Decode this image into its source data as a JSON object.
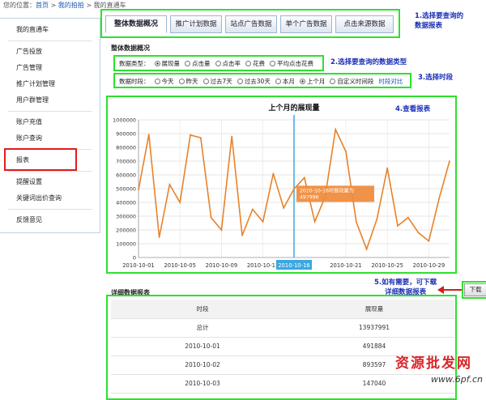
{
  "breadcrumb": {
    "prefix": "您的位置：",
    "home": "首页",
    "sep1": " > ",
    "crumb2": "我的拍拍",
    "sep2": " > ",
    "crumb3": "我的直通车"
  },
  "sidebar": {
    "items": [
      {
        "label": "我的直通车"
      },
      {
        "label": "广告投放"
      },
      {
        "label": "广告管理"
      },
      {
        "label": "推广计划管理"
      },
      {
        "label": "用户群管理"
      },
      {
        "label": "账户充值"
      },
      {
        "label": "账户查询"
      },
      {
        "label": "报表"
      },
      {
        "label": "提醒设置"
      },
      {
        "label": "关键词出价查询"
      },
      {
        "label": "反馈意见"
      }
    ]
  },
  "tabs": [
    {
      "label": "整体数据概况"
    },
    {
      "label": "推广计划数据"
    },
    {
      "label": "站点广告数据"
    },
    {
      "label": "单个广告数据"
    },
    {
      "label": "点击来源数据"
    }
  ],
  "annotations": {
    "a1": "1.选择要查询的",
    "a1b": "数据报表",
    "a2": "2.选择要查询的数据类型",
    "a3": "3.选择时段",
    "a4": "4.查看报表",
    "a5": "5.如有需要，可下载",
    "a5b": "详细数据报表"
  },
  "overview_title": "整体数据概况",
  "data_type": {
    "label": "数据类型：",
    "options": [
      "展现量",
      "点击量",
      "点击率",
      "花费",
      "平均点击花费"
    ],
    "selected": 0
  },
  "period": {
    "label": "数据时段：",
    "options": [
      "今天",
      "昨天",
      "过去7天",
      "过去30天",
      "本月",
      "上个月",
      "自定义时间段"
    ],
    "selected": 5,
    "compare_link": "时段对比"
  },
  "chart_data": {
    "type": "line",
    "title": "上个月的展现量",
    "x": [
      "2010-10-01",
      "2010-10-02",
      "2010-10-03",
      "2010-10-04",
      "2010-10-05",
      "2010-10-06",
      "2010-10-07",
      "2010-10-08",
      "2010-10-09",
      "2010-10-10",
      "2010-10-11",
      "2010-10-12",
      "2010-10-13",
      "2010-10-14",
      "2010-10-15",
      "2010-10-16",
      "2010-10-17",
      "2010-10-18",
      "2010-10-19",
      "2010-10-20",
      "2010-10-21",
      "2010-10-22",
      "2010-10-23",
      "2010-10-24",
      "2010-10-25",
      "2010-10-26",
      "2010-10-27",
      "2010-10-28",
      "2010-10-29",
      "2010-10-30",
      "2010-10-31"
    ],
    "series": [
      {
        "values": [
          491884,
          893597,
          147040,
          530000,
          400000,
          890000,
          870000,
          290000,
          200000,
          880000,
          160000,
          350000,
          260000,
          610000,
          360000,
          497996,
          580000,
          260000,
          440000,
          930000,
          770000,
          260000,
          60000,
          280000,
          650000,
          230000,
          290000,
          180000,
          120000,
          430000,
          700000
        ]
      }
    ],
    "xtick_labels": [
      "2010-10-01",
      "2010-10-05",
      "2010-10-09",
      "2010-10-13",
      "2010-10-16",
      "2010-10-21",
      "2010-10-25",
      "2010-10-29"
    ],
    "xtick_index": [
      0,
      4,
      8,
      12,
      15,
      20,
      24,
      28
    ],
    "y_ticks": [
      "0",
      "100000",
      "200000",
      "300000",
      "400000",
      "500000",
      "600000",
      "700000",
      "800000",
      "900000",
      "1000000"
    ],
    "ylim": [
      0,
      1000000
    ],
    "highlight_index": 15,
    "highlight_x_label": "2010-10-16",
    "tooltip": "2010-10-16时展现量为 497996",
    "line_color": "#e8822a",
    "cursor_color": "#3ca7e0"
  },
  "download_button": "下载",
  "detail_title": "详细数据报表",
  "table": {
    "headers": [
      "时段",
      "展现量"
    ],
    "rows": [
      [
        "总计",
        "13937991"
      ],
      [
        "2010-10-01",
        "491884"
      ],
      [
        "2010-10-02",
        "893597"
      ],
      [
        "2010-10-03",
        "147040"
      ]
    ]
  },
  "watermark": {
    "text": "资源批发网",
    "url": "www.6pf.cn"
  }
}
